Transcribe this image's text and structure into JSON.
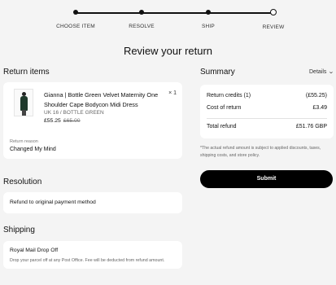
{
  "steps": [
    {
      "label": "CHOOSE ITEM",
      "state": "done"
    },
    {
      "label": "RESOLVE",
      "state": "done"
    },
    {
      "label": "SHIP",
      "state": "done"
    },
    {
      "label": "REVIEW",
      "state": "current"
    }
  ],
  "page_title": "Review your return",
  "return_items": {
    "title": "Return items",
    "item": {
      "image_icon": "product-photo-dress",
      "name": "Gianna | Bottle Green Velvet Maternity One Shoulder Cape Bodycon Midi Dress",
      "qty": "× 1",
      "variant": "UK 16 / BOTTLE GREEN",
      "price": "£55.25",
      "was_price": "£65.00",
      "reason_label": "Return reason",
      "reason_value": "Changed My Mind"
    }
  },
  "resolution": {
    "title": "Resolution",
    "value": "Refund to original payment method"
  },
  "shipping": {
    "title": "Shipping",
    "method": "Royal Mail Drop Off",
    "note": "Drop your parcel off at any Post Office. Fee will be deducted from refund amount."
  },
  "summary": {
    "title": "Summary",
    "details_label": "Details",
    "rows": [
      {
        "label": "Return credits (1)",
        "value": "(£55.25)"
      },
      {
        "label": "Cost of return",
        "value": "£3.49"
      }
    ],
    "total_label": "Total refund",
    "total_value": "£51.76 GBP",
    "disclaimer": "*The actual refund amount is subject to applied discounts, taxes, shipping costs, and store policy.",
    "submit_label": "Submit"
  },
  "colors": {
    "accent": "#000000",
    "background": "#f4f4f4",
    "card": "#ffffff"
  }
}
